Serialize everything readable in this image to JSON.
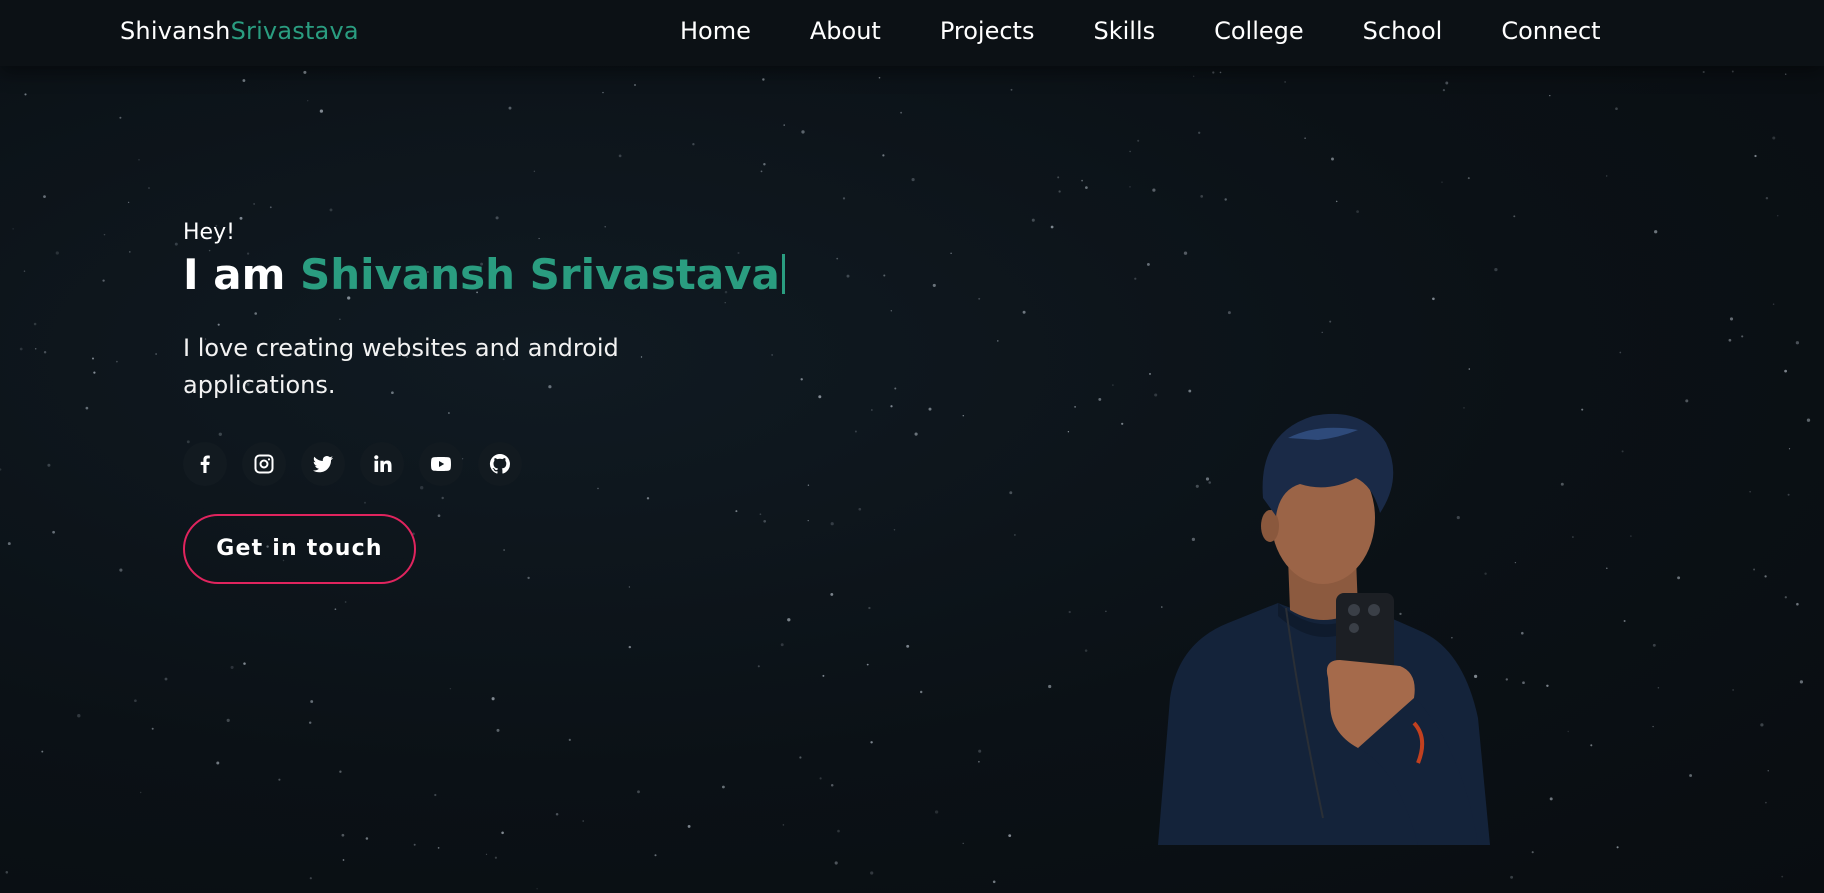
{
  "brand": {
    "first": "Shivansh",
    "last": "Srivastava"
  },
  "nav": {
    "items": [
      {
        "label": "Home"
      },
      {
        "label": "About"
      },
      {
        "label": "Projects"
      },
      {
        "label": "Skills"
      },
      {
        "label": "College"
      },
      {
        "label": "School"
      },
      {
        "label": "Connect"
      }
    ]
  },
  "hero": {
    "greeting": "Hey!",
    "intro": "I am",
    "name": "Shivansh Srivastava",
    "tagline": "I love creating websites and android applications.",
    "cta_label": "Get in touch"
  },
  "socials": [
    {
      "icon": "facebook-icon"
    },
    {
      "icon": "instagram-icon"
    },
    {
      "icon": "twitter-icon"
    },
    {
      "icon": "linkedin-icon"
    },
    {
      "icon": "youtube-icon"
    },
    {
      "icon": "github-icon"
    }
  ],
  "colors": {
    "background": "#0b1014",
    "accent": "#2a9d80",
    "cta_border": "#e0245e",
    "text": "#ffffff"
  }
}
